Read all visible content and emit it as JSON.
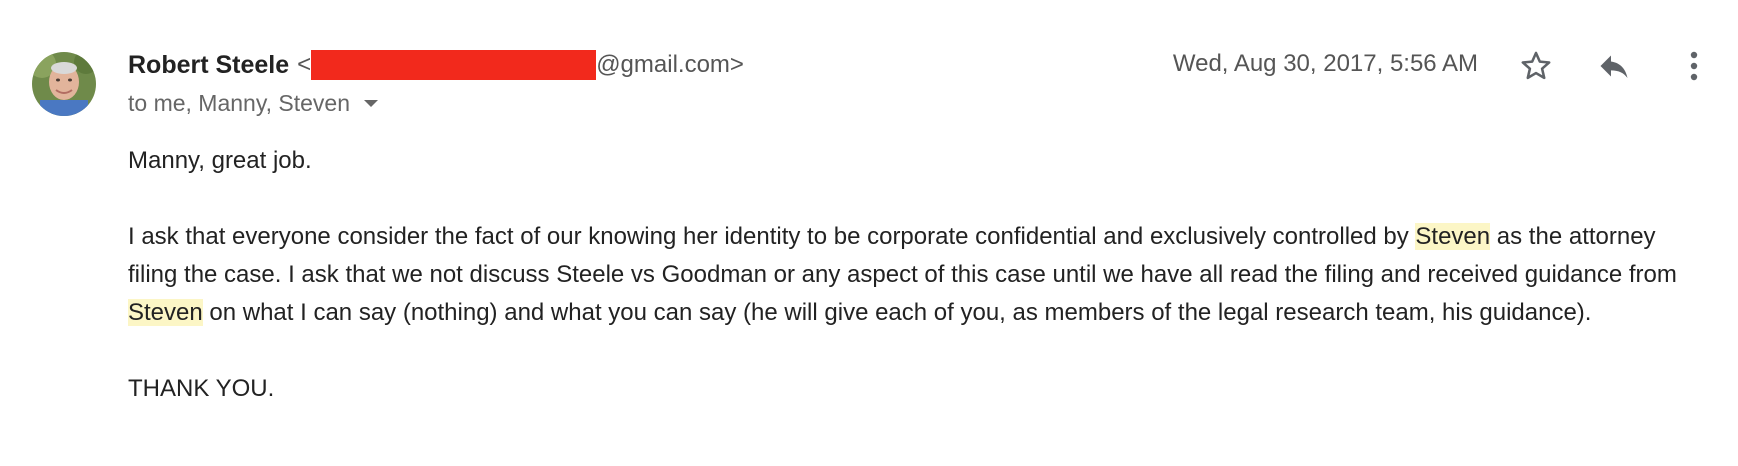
{
  "message": {
    "sender_name": "Robert Steele",
    "sender_email_open": "<",
    "sender_email_domain": "@gmail.com>",
    "recipients": "to me, Manny, Steven",
    "date": "Wed, Aug 30, 2017, 5:56 AM",
    "icons": {
      "avatar": "sender-avatar",
      "star": "star-outline-icon",
      "reply": "reply-arrow-icon",
      "more": "vertical-more-icon",
      "caret": "dropdown-caret-icon"
    },
    "colors": {
      "redaction": "#f2291c",
      "highlight": "#fcf6c6"
    },
    "body": {
      "line1": "Manny, great job.",
      "p2_a": "I ask that everyone consider the fact of our knowing her identity to be corporate confidential and exclusively controlled by ",
      "p2_hl1": "Steven",
      "p2_b": " as the attorney filing the case.  I ask that we not discuss Steele vs Goodman or any aspect of this case until we have all read the filing and received guidance from ",
      "p2_hl2": "Steven",
      "p2_c": " on what I can say (nothing) and what you can say (he will give each of you, as members of the legal research team, his guidance).",
      "closing": "THANK YOU."
    }
  }
}
